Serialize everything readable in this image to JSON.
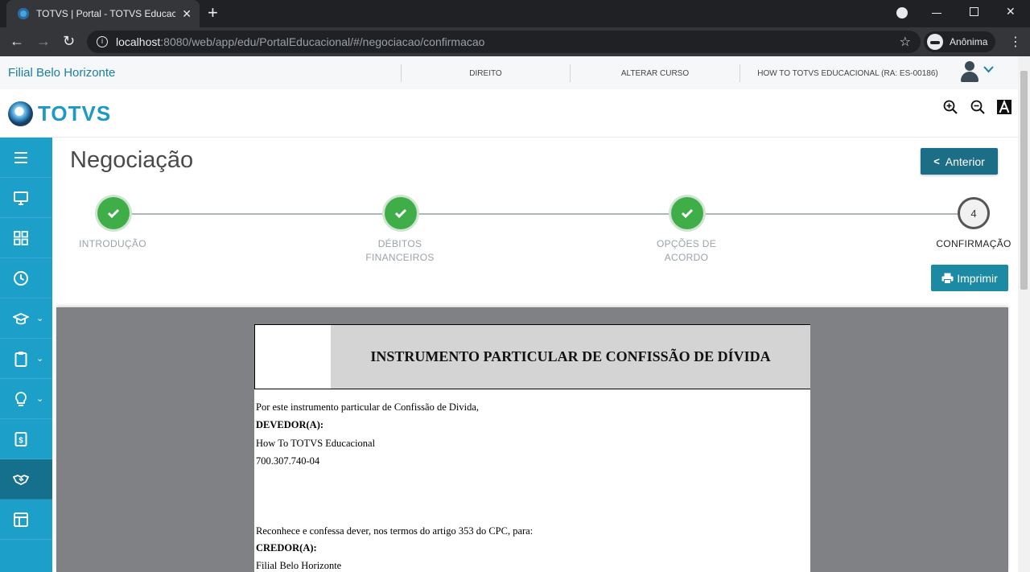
{
  "browser": {
    "tab_title": "TOTVS | Portal - TOTVS Educacional",
    "tab_close": "✕",
    "new_tab": "+",
    "url_host": "localhost",
    "url_path": ":8080/web/app/edu/PortalEducacional/#/negociacao/confirmacao",
    "incognito_label": "Anônima"
  },
  "topbar": {
    "branch": "Filial Belo Horizonte",
    "links": [
      "DIREITO",
      "ALTERAR CURSO",
      "HOW TO TOTVS EDUCACIONAL (RA: ES-00186)"
    ]
  },
  "logo": {
    "text": "TOTVS"
  },
  "sidebar": {
    "items": [
      {
        "icon": "menu-icon"
      },
      {
        "icon": "monitor-icon"
      },
      {
        "icon": "grid-icon"
      },
      {
        "icon": "clock-icon"
      },
      {
        "icon": "graduation-cap-icon",
        "has_submenu": true
      },
      {
        "icon": "clipboard-icon",
        "has_submenu": true
      },
      {
        "icon": "lightbulb-icon",
        "has_submenu": true
      },
      {
        "icon": "money-document-icon"
      },
      {
        "icon": "handshake-icon",
        "active": true
      },
      {
        "icon": "layout-icon"
      }
    ]
  },
  "page": {
    "title": "Negociação",
    "prev_button": "Anterior",
    "print_button": "Imprimir"
  },
  "stepper": {
    "steps": [
      {
        "label_1": "INTRODUÇÃO",
        "label_2": "",
        "status": "done"
      },
      {
        "label_1": "DÉBITOS",
        "label_2": "FINANCEIROS",
        "status": "done"
      },
      {
        "label_1": "OPÇÕES DE",
        "label_2": "ACORDO",
        "status": "done"
      },
      {
        "label_1": "CONFIRMAÇÃO",
        "label_2": "",
        "status": "current",
        "number": "4"
      }
    ]
  },
  "document": {
    "title": "INSTRUMENTO PARTICULAR DE CONFISSÃO DE DÍVIDA",
    "intro": "Por este instrumento particular de Confissão de Divida,",
    "debtor_label": "DEVEDOR(A):",
    "debtor_name": "How To TOTVS Educacional",
    "debtor_doc": "700.307.740-04",
    "acknowledgement": "Reconhece e confessa dever, nos termos do artigo 353 do CPC, para:",
    "creditor_label": "CREDOR(A):",
    "creditor_name": "Filial Belo Horizonte"
  },
  "colors": {
    "accent": "#1c9fc9",
    "sidebar_active": "#15708e",
    "step_done": "#3fae49",
    "button": "#1c6d86"
  }
}
